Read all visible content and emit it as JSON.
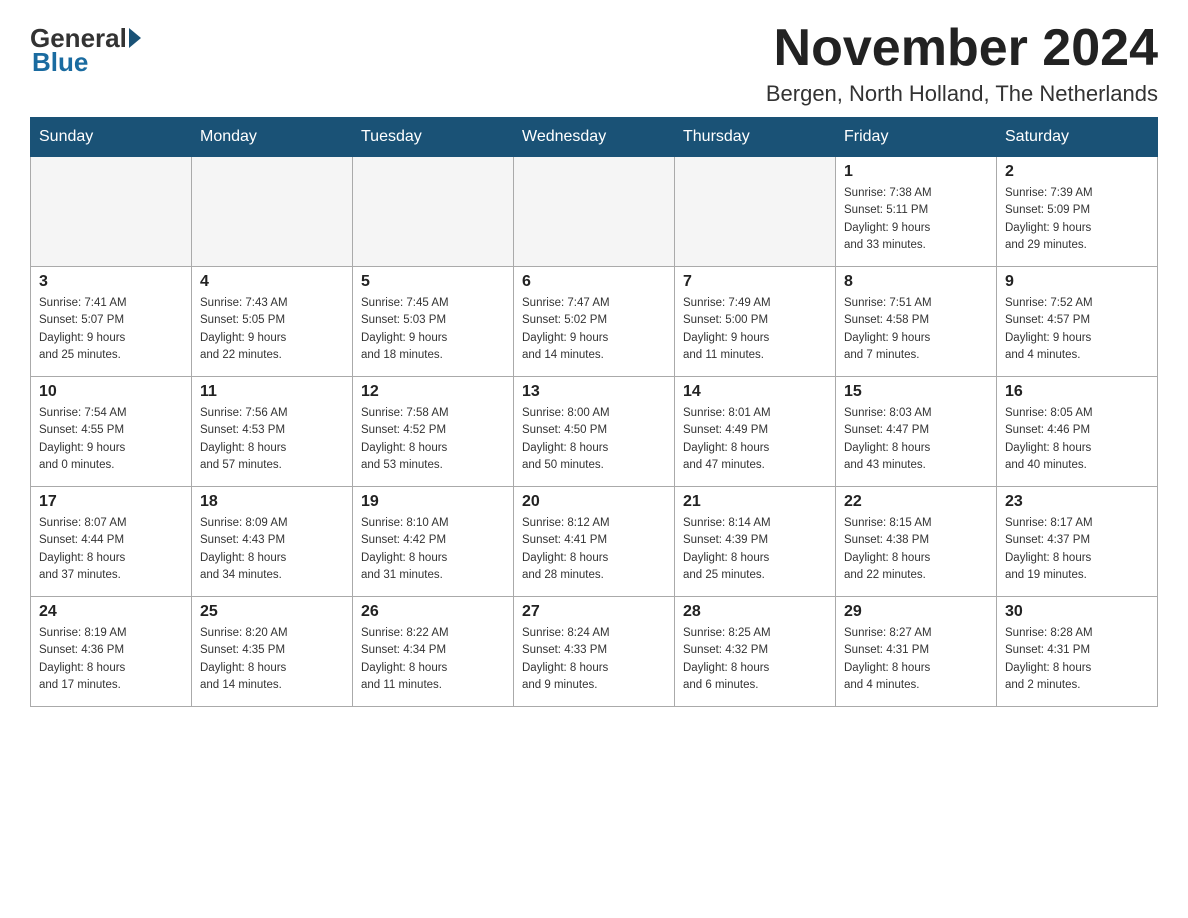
{
  "header": {
    "month_title": "November 2024",
    "location": "Bergen, North Holland, The Netherlands"
  },
  "logo": {
    "general": "General",
    "blue": "Blue"
  },
  "days_of_week": [
    "Sunday",
    "Monday",
    "Tuesday",
    "Wednesday",
    "Thursday",
    "Friday",
    "Saturday"
  ],
  "weeks": [
    [
      {
        "day": "",
        "info": ""
      },
      {
        "day": "",
        "info": ""
      },
      {
        "day": "",
        "info": ""
      },
      {
        "day": "",
        "info": ""
      },
      {
        "day": "",
        "info": ""
      },
      {
        "day": "1",
        "info": "Sunrise: 7:38 AM\nSunset: 5:11 PM\nDaylight: 9 hours\nand 33 minutes."
      },
      {
        "day": "2",
        "info": "Sunrise: 7:39 AM\nSunset: 5:09 PM\nDaylight: 9 hours\nand 29 minutes."
      }
    ],
    [
      {
        "day": "3",
        "info": "Sunrise: 7:41 AM\nSunset: 5:07 PM\nDaylight: 9 hours\nand 25 minutes."
      },
      {
        "day": "4",
        "info": "Sunrise: 7:43 AM\nSunset: 5:05 PM\nDaylight: 9 hours\nand 22 minutes."
      },
      {
        "day": "5",
        "info": "Sunrise: 7:45 AM\nSunset: 5:03 PM\nDaylight: 9 hours\nand 18 minutes."
      },
      {
        "day": "6",
        "info": "Sunrise: 7:47 AM\nSunset: 5:02 PM\nDaylight: 9 hours\nand 14 minutes."
      },
      {
        "day": "7",
        "info": "Sunrise: 7:49 AM\nSunset: 5:00 PM\nDaylight: 9 hours\nand 11 minutes."
      },
      {
        "day": "8",
        "info": "Sunrise: 7:51 AM\nSunset: 4:58 PM\nDaylight: 9 hours\nand 7 minutes."
      },
      {
        "day": "9",
        "info": "Sunrise: 7:52 AM\nSunset: 4:57 PM\nDaylight: 9 hours\nand 4 minutes."
      }
    ],
    [
      {
        "day": "10",
        "info": "Sunrise: 7:54 AM\nSunset: 4:55 PM\nDaylight: 9 hours\nand 0 minutes."
      },
      {
        "day": "11",
        "info": "Sunrise: 7:56 AM\nSunset: 4:53 PM\nDaylight: 8 hours\nand 57 minutes."
      },
      {
        "day": "12",
        "info": "Sunrise: 7:58 AM\nSunset: 4:52 PM\nDaylight: 8 hours\nand 53 minutes."
      },
      {
        "day": "13",
        "info": "Sunrise: 8:00 AM\nSunset: 4:50 PM\nDaylight: 8 hours\nand 50 minutes."
      },
      {
        "day": "14",
        "info": "Sunrise: 8:01 AM\nSunset: 4:49 PM\nDaylight: 8 hours\nand 47 minutes."
      },
      {
        "day": "15",
        "info": "Sunrise: 8:03 AM\nSunset: 4:47 PM\nDaylight: 8 hours\nand 43 minutes."
      },
      {
        "day": "16",
        "info": "Sunrise: 8:05 AM\nSunset: 4:46 PM\nDaylight: 8 hours\nand 40 minutes."
      }
    ],
    [
      {
        "day": "17",
        "info": "Sunrise: 8:07 AM\nSunset: 4:44 PM\nDaylight: 8 hours\nand 37 minutes."
      },
      {
        "day": "18",
        "info": "Sunrise: 8:09 AM\nSunset: 4:43 PM\nDaylight: 8 hours\nand 34 minutes."
      },
      {
        "day": "19",
        "info": "Sunrise: 8:10 AM\nSunset: 4:42 PM\nDaylight: 8 hours\nand 31 minutes."
      },
      {
        "day": "20",
        "info": "Sunrise: 8:12 AM\nSunset: 4:41 PM\nDaylight: 8 hours\nand 28 minutes."
      },
      {
        "day": "21",
        "info": "Sunrise: 8:14 AM\nSunset: 4:39 PM\nDaylight: 8 hours\nand 25 minutes."
      },
      {
        "day": "22",
        "info": "Sunrise: 8:15 AM\nSunset: 4:38 PM\nDaylight: 8 hours\nand 22 minutes."
      },
      {
        "day": "23",
        "info": "Sunrise: 8:17 AM\nSunset: 4:37 PM\nDaylight: 8 hours\nand 19 minutes."
      }
    ],
    [
      {
        "day": "24",
        "info": "Sunrise: 8:19 AM\nSunset: 4:36 PM\nDaylight: 8 hours\nand 17 minutes."
      },
      {
        "day": "25",
        "info": "Sunrise: 8:20 AM\nSunset: 4:35 PM\nDaylight: 8 hours\nand 14 minutes."
      },
      {
        "day": "26",
        "info": "Sunrise: 8:22 AM\nSunset: 4:34 PM\nDaylight: 8 hours\nand 11 minutes."
      },
      {
        "day": "27",
        "info": "Sunrise: 8:24 AM\nSunset: 4:33 PM\nDaylight: 8 hours\nand 9 minutes."
      },
      {
        "day": "28",
        "info": "Sunrise: 8:25 AM\nSunset: 4:32 PM\nDaylight: 8 hours\nand 6 minutes."
      },
      {
        "day": "29",
        "info": "Sunrise: 8:27 AM\nSunset: 4:31 PM\nDaylight: 8 hours\nand 4 minutes."
      },
      {
        "day": "30",
        "info": "Sunrise: 8:28 AM\nSunset: 4:31 PM\nDaylight: 8 hours\nand 2 minutes."
      }
    ]
  ]
}
